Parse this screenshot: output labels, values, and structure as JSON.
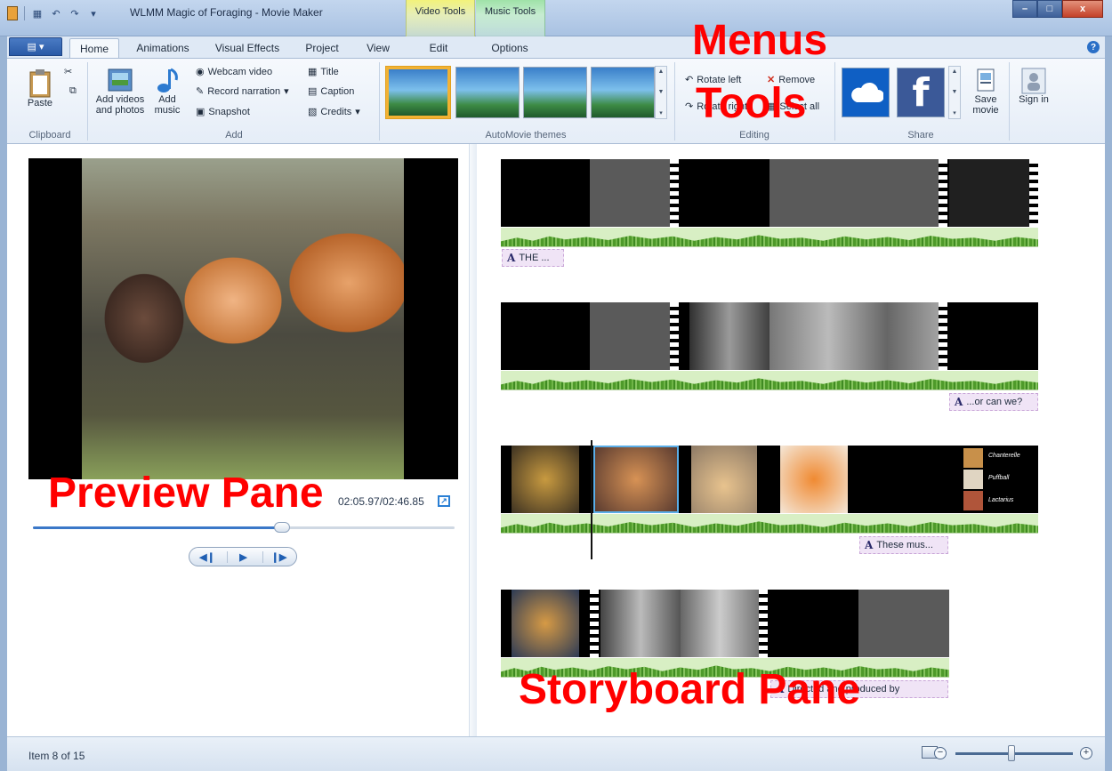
{
  "window": {
    "title": "WLMM Magic of Foraging - Movie Maker",
    "context_tabs": [
      "Video Tools",
      "Music Tools"
    ],
    "controls": {
      "minimize": "–",
      "maximize": "□",
      "close": "x"
    }
  },
  "tabs": [
    {
      "label": "Home",
      "active": true
    },
    {
      "label": "Animations"
    },
    {
      "label": "Visual Effects"
    },
    {
      "label": "Project"
    },
    {
      "label": "View"
    },
    {
      "label": "Edit"
    },
    {
      "label": "Options"
    }
  ],
  "ribbon": {
    "clipboard": {
      "paste": "Paste",
      "group": "Clipboard"
    },
    "add": {
      "add_videos": "Add videos and photos",
      "add_music": "Add music",
      "webcam": "Webcam video",
      "record_narration": "Record narration",
      "snapshot": "Snapshot",
      "title": "Title",
      "caption": "Caption",
      "credits": "Credits",
      "group": "Add"
    },
    "themes": {
      "group": "AutoMovie themes"
    },
    "editing": {
      "rotate_left": "Rotate left",
      "rotate_right": "Rotate right",
      "remove": "Remove",
      "select_all": "Select all",
      "group": "Editing"
    },
    "share": {
      "save_movie": "Save movie",
      "group": "Share"
    },
    "sign_in": "Sign in"
  },
  "preview": {
    "time": "02:05.97/02:46.85",
    "progress": 0.59
  },
  "storyboard": {
    "captions": [
      "THE ...",
      "...or can we?",
      "These mus...",
      "Directed and produced by"
    ],
    "names": [
      "Chanterelle",
      "Puffball",
      "Lactarius"
    ]
  },
  "overlays": {
    "menus": "Menus",
    "tools": "Tools",
    "preview_pane": "Preview Pane",
    "storyboard_pane": "Storyboard Pane"
  },
  "status": {
    "item": "Item 8 of 15",
    "zoom": 0.48
  }
}
